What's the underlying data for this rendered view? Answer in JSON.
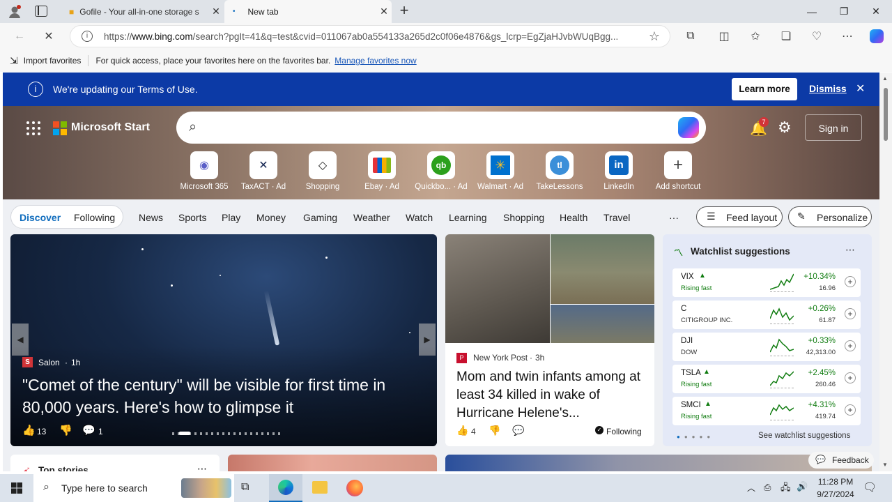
{
  "browser": {
    "tabs": [
      {
        "title": "Gofile - Your all-in-one storage s",
        "active": false
      },
      {
        "title": "New tab",
        "active": true
      }
    ],
    "url_prefix": "https://",
    "url_host": "www.bing.com",
    "url_rest": "/search?pgIt=41&q=test&cvid=011067ab0a554133a265d2c0f06e4876&gs_lcrp=EgZjaHJvbWUqBgg...",
    "favorites": {
      "import_label": "Import favorites",
      "hint": "For quick access, place your favorites here on the favorites bar.",
      "manage_link": "Manage favorites now"
    }
  },
  "banner": {
    "text": "We're updating our Terms of Use.",
    "learn_more": "Learn more",
    "dismiss": "Dismiss"
  },
  "header": {
    "brand": "Microsoft Start",
    "notification_count": "7",
    "sign_in": "Sign in"
  },
  "shortcuts": [
    {
      "label": "Microsoft 365",
      "icon": "microsoft365-icon"
    },
    {
      "label": "TaxACT · Ad",
      "icon": "taxact-icon"
    },
    {
      "label": "Shopping",
      "icon": "tag-icon"
    },
    {
      "label": "Ebay · Ad",
      "icon": "ebay-icon"
    },
    {
      "label": "Quickbo... · Ad",
      "icon": "quickbooks-icon"
    },
    {
      "label": "Walmart · Ad",
      "icon": "walmart-icon"
    },
    {
      "label": "TakeLessons",
      "icon": "takelessons-icon"
    },
    {
      "label": "LinkedIn",
      "icon": "linkedin-icon"
    },
    {
      "label": "Add shortcut",
      "icon": "plus-icon"
    }
  ],
  "feed_nav": {
    "discover": "Discover",
    "following": "Following",
    "items": [
      "News",
      "Sports",
      "Play",
      "Money",
      "Gaming",
      "Weather",
      "Watch",
      "Learning",
      "Shopping",
      "Health",
      "Travel"
    ],
    "more": "···",
    "feed_layout": "Feed layout",
    "personalize": "Personalize"
  },
  "hero_card": {
    "source": "Salon",
    "time": "1h",
    "headline": "\"Comet of the century\" will be visible for first time in 80,000 years. Here's how to glimpse it",
    "likes": "13",
    "comments": "1"
  },
  "news_card": {
    "source": "New York Post",
    "time": "3h",
    "headline": "Mom and twin infants among at least 34 killed in wake of Hurricane Helene's...",
    "likes": "4",
    "following": "Following"
  },
  "watchlist": {
    "title": "Watchlist suggestions",
    "rows": [
      {
        "symbol": "VIX",
        "sub": "Rising fast",
        "change": "+10.34%",
        "price": "16.96",
        "rising": true
      },
      {
        "symbol": "C",
        "sub": "CITIGROUP INC.",
        "change": "+0.26%",
        "price": "61.87",
        "rising": false
      },
      {
        "symbol": "DJI",
        "sub": "DOW",
        "change": "+0.33%",
        "price": "42,313.00",
        "rising": false
      },
      {
        "symbol": "TSLA",
        "sub": "Rising fast",
        "change": "+2.45%",
        "price": "260.46",
        "rising": true
      },
      {
        "symbol": "SMCI",
        "sub": "Rising fast",
        "change": "+4.31%",
        "price": "419.74",
        "rising": true
      }
    ],
    "see_more": "See watchlist suggestions"
  },
  "top_stories": "Top stories",
  "feedback": "Feedback",
  "taskbar": {
    "search_placeholder": "Type here to search",
    "time": "11:28 PM",
    "date": "9/27/2024"
  },
  "colors": {
    "banner": "#0c3aa6",
    "accent": "#0f6cbd",
    "positive": "#107c10"
  }
}
